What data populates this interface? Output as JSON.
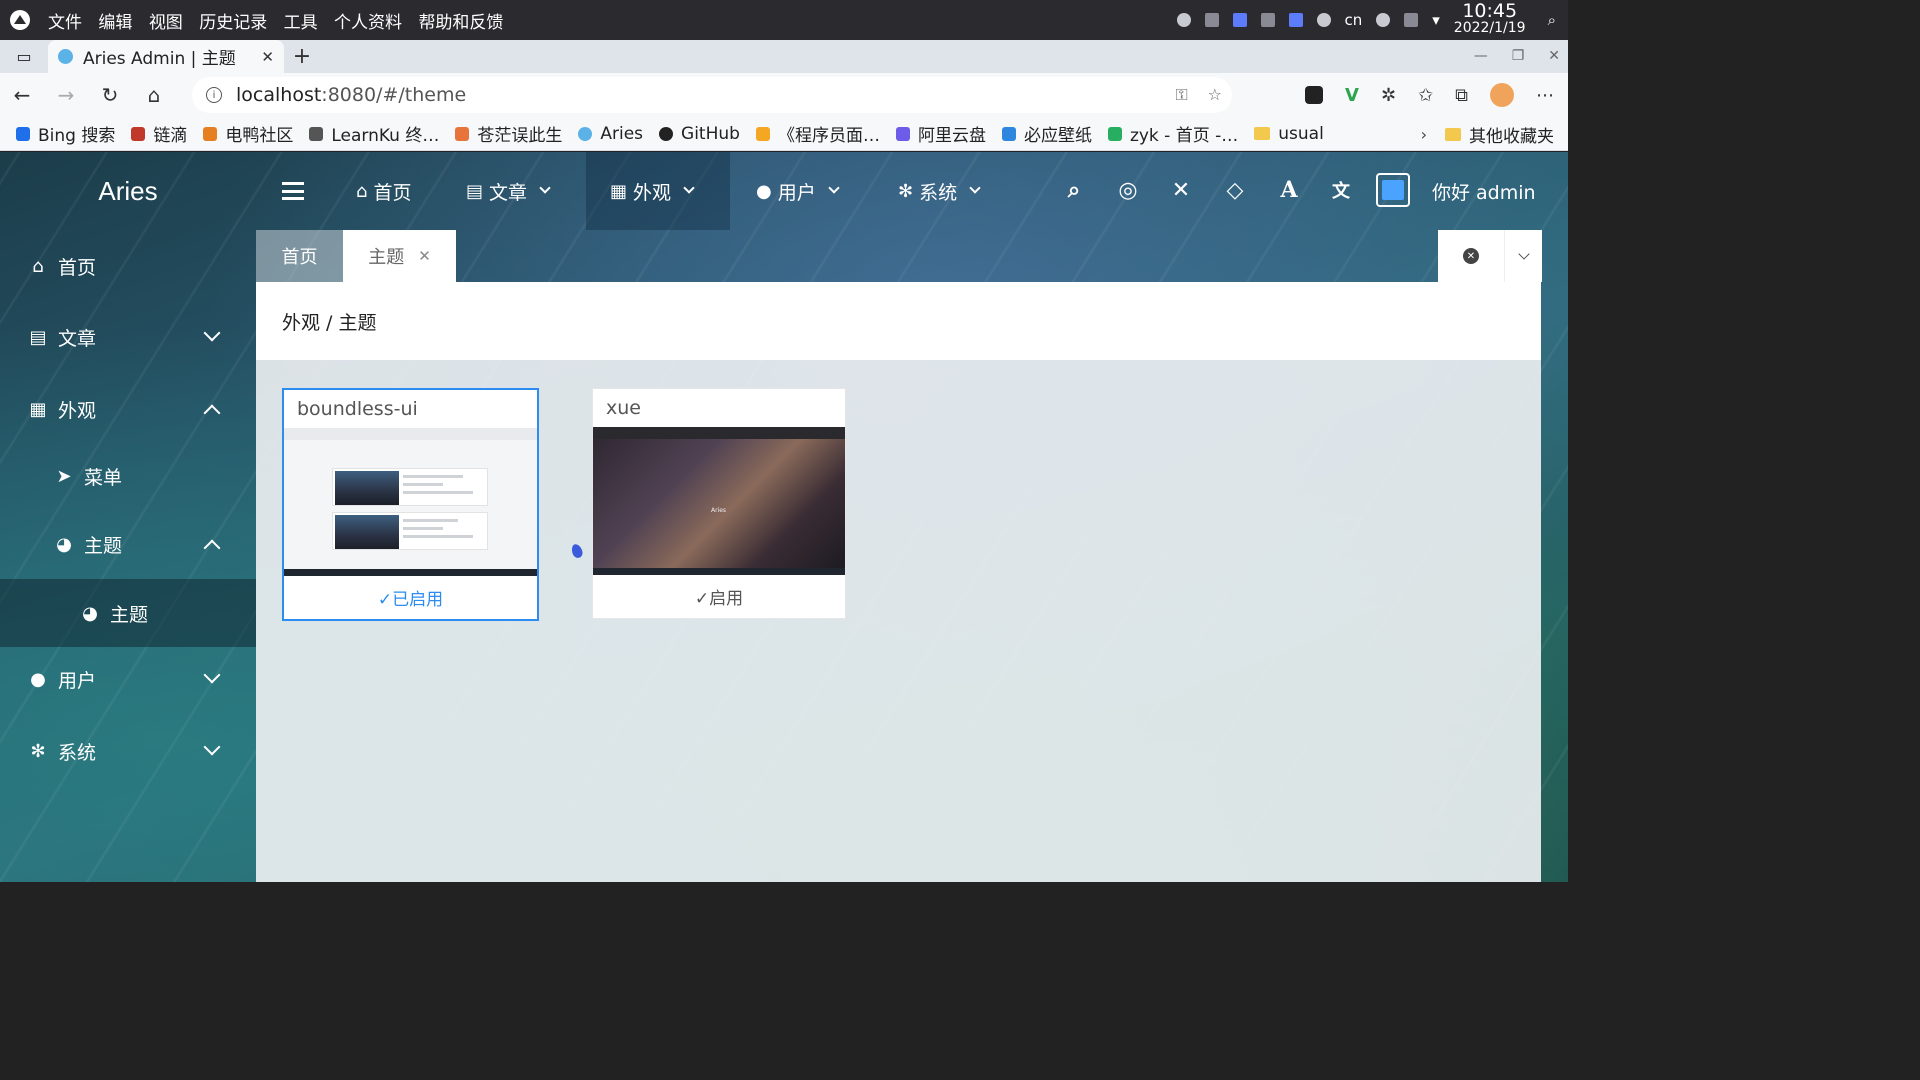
{
  "os": {
    "menu": [
      "文件",
      "编辑",
      "视图",
      "历史记录",
      "工具",
      "个人资料",
      "帮助和反馈"
    ],
    "lang": "cn",
    "time": "10:45",
    "date": "2022/1/19"
  },
  "browser": {
    "tab_title": "Aries Admin | 主题",
    "url_host": "localhost",
    "url_rest": ":8080/#/theme",
    "bookmarks": [
      "Bing 搜索",
      "链滴",
      "电鸭社区",
      "LearnKu 终…",
      "苍茫误此生",
      "Aries",
      "GitHub",
      "《程序员面…",
      "阿里云盘",
      "必应壁纸",
      "zyk - 首页 -…",
      "usual"
    ],
    "bookmarks_other": "其他收藏夹"
  },
  "app": {
    "brand": "Aries",
    "topnav": {
      "home": "首页",
      "article": "文章",
      "appearance": "外观",
      "user": "用户",
      "system": "系统",
      "greeting": "你好 admin"
    },
    "sidebar": {
      "home": "首页",
      "article": "文章",
      "appearance": "外观",
      "menu": "菜单",
      "theme": "主题",
      "theme_sub": "主题",
      "user": "用户",
      "system": "系统"
    },
    "tabs": {
      "home": "首页",
      "current": "主题"
    },
    "breadcrumb": "外观 / 主题",
    "themes": [
      {
        "name": "boundless-ui",
        "status": "✓已启用",
        "enabled": true
      },
      {
        "name": "xue",
        "status": "✓启用",
        "enabled": false
      }
    ],
    "thumb_logo": "Aries"
  },
  "colors": {
    "accent": "#2d8cf0",
    "os_bar": "#2b2b2f"
  }
}
